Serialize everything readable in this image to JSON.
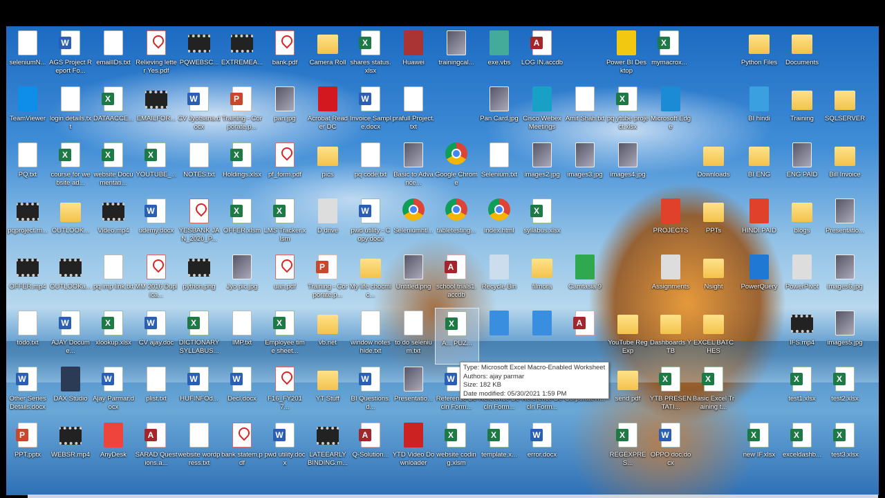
{
  "desktop": {
    "icons": [
      {
        "label": "seleniumN...",
        "type": "doc"
      },
      {
        "label": "AGS Project Report Fo...",
        "type": "word"
      },
      {
        "label": "emailIDs.txt",
        "type": "doc"
      },
      {
        "label": "Relieving letter Yes.pdf",
        "type": "pdf"
      },
      {
        "label": "PQWEBSC...",
        "type": "video"
      },
      {
        "label": "EXTREMEA...",
        "type": "video"
      },
      {
        "label": "bank.pdf",
        "type": "pdf"
      },
      {
        "label": "Camera Roll",
        "type": "folder"
      },
      {
        "label": "shares status.xlsx",
        "type": "excel"
      },
      {
        "label": "Huawei",
        "type": "app",
        "color": "#a33"
      },
      {
        "label": "trainingcal...",
        "type": "image"
      },
      {
        "label": "exe.vbs",
        "type": "app",
        "color": "#4a9"
      },
      {
        "label": "LOG IN.accdb",
        "type": "access"
      },
      {
        "label": "Power BI Desktop",
        "type": "app",
        "color": "#f2c811"
      },
      {
        "label": "mymacrox...",
        "type": "excel"
      },
      {
        "label": "Python Files",
        "type": "folder"
      },
      {
        "label": "Documents",
        "type": "folder"
      },
      {
        "label": "TeamViewer",
        "type": "app",
        "color": "#0e8ee9"
      },
      {
        "label": "login details.txt",
        "type": "doc"
      },
      {
        "label": "DATAACCE...",
        "type": "excel"
      },
      {
        "label": "EMAILFOR...",
        "type": "video"
      },
      {
        "label": "CV Jyotsana.docx",
        "type": "word"
      },
      {
        "label": "Training - Corporate.p...",
        "type": "ppt"
      },
      {
        "label": "pan.jpg",
        "type": "image"
      },
      {
        "label": "Acrobat Reader DC",
        "type": "app",
        "color": "#d4181f"
      },
      {
        "label": "Invoice Sample.docx",
        "type": "word"
      },
      {
        "label": "prafull Project.txt",
        "type": "doc"
      },
      {
        "label": "Pan Card.jpg",
        "type": "image"
      },
      {
        "label": "Cisco Webex Meetings",
        "type": "app",
        "color": "#19a0c7"
      },
      {
        "label": "Amit Shah.txt",
        "type": "doc"
      },
      {
        "label": "pq ytube project.xlsx",
        "type": "excel"
      },
      {
        "label": "Microsoft Edge",
        "type": "app",
        "color": "#1a8bd4"
      },
      {
        "label": "BI hindi",
        "type": "app",
        "color": "#3aa0e0"
      },
      {
        "label": "Training",
        "type": "folder"
      },
      {
        "label": "SQLSERVER",
        "type": "folder"
      },
      {
        "label": "PQ.txt",
        "type": "doc"
      },
      {
        "label": "course for website ad...",
        "type": "excel"
      },
      {
        "label": "website Documentati...",
        "type": "excel"
      },
      {
        "label": "YOUTUBE_...",
        "type": "excel"
      },
      {
        "label": "NOTES.txt",
        "type": "doc"
      },
      {
        "label": "Holdings.xlsx",
        "type": "excel"
      },
      {
        "label": "pf_form.pdf",
        "type": "pdf"
      },
      {
        "label": "pics",
        "type": "folder"
      },
      {
        "label": "pq code.txt",
        "type": "doc"
      },
      {
        "label": "Basic to Advance...",
        "type": "image"
      },
      {
        "label": "Google Chrome",
        "type": "chrome"
      },
      {
        "label": "Selenium.txt",
        "type": "doc"
      },
      {
        "label": "images2.jpg",
        "type": "image"
      },
      {
        "label": "images3.jpg",
        "type": "image"
      },
      {
        "label": "images4.jpg",
        "type": "image"
      },
      {
        "label": "Downloads",
        "type": "folder"
      },
      {
        "label": "BI ENG",
        "type": "folder"
      },
      {
        "label": "ENG PAID",
        "type": "image"
      },
      {
        "label": "Bill Invoice",
        "type": "folder"
      },
      {
        "label": "pqproject.m...",
        "type": "video"
      },
      {
        "label": "OUTLOOK...",
        "type": "folder"
      },
      {
        "label": "Video.mp4",
        "type": "video"
      },
      {
        "label": "udemy.docx",
        "type": "word"
      },
      {
        "label": "YESBANK JAN_2020_P...",
        "type": "pdf"
      },
      {
        "label": "OFFER.xlsm",
        "type": "excel"
      },
      {
        "label": "LMS Tracker.xlsm",
        "type": "excel"
      },
      {
        "label": "D drive",
        "type": "app",
        "color": "#ddd"
      },
      {
        "label": "pwd utility - Copy.docx",
        "type": "word"
      },
      {
        "label": "Seleniumhtl...",
        "type": "chrome"
      },
      {
        "label": "tabletesting...",
        "type": "chrome"
      },
      {
        "label": "index.html",
        "type": "chrome"
      },
      {
        "label": "syllabus.xlsx",
        "type": "excel"
      },
      {
        "label": "PROJECTS",
        "type": "app",
        "color": "#e0412a"
      },
      {
        "label": "PPTs",
        "type": "folder"
      },
      {
        "label": "HINDI PAID",
        "type": "app",
        "color": "#e0412a"
      },
      {
        "label": "blogs",
        "type": "folder"
      },
      {
        "label": "Presentatio...",
        "type": "image"
      },
      {
        "label": "OFFER.mp4",
        "type": "video"
      },
      {
        "label": "OUTLOOKa...",
        "type": "video"
      },
      {
        "label": "pq imp link.txt",
        "type": "doc"
      },
      {
        "label": "MM 2016 Duplica...",
        "type": "pdf"
      },
      {
        "label": "python.png",
        "type": "video"
      },
      {
        "label": "Jyo pic.jpg",
        "type": "image"
      },
      {
        "label": "uan.pdf",
        "type": "pdf"
      },
      {
        "label": "Training - Corporate.p...",
        "type": "ppt"
      },
      {
        "label": "My life chocmic...",
        "type": "folder"
      },
      {
        "label": "Untitled.png",
        "type": "image"
      },
      {
        "label": "school trials1.accdb",
        "type": "access"
      },
      {
        "label": "Recycle Bin",
        "type": "app",
        "color": "#cde"
      },
      {
        "label": "filmora",
        "type": "folder"
      },
      {
        "label": "Camtasia 9",
        "type": "app",
        "color": "#2fa84f"
      },
      {
        "label": "Assignments",
        "type": "app",
        "color": "#ddd"
      },
      {
        "label": "Nsight",
        "type": "folder"
      },
      {
        "label": "PowerQuery",
        "type": "app",
        "color": "#1e78d4"
      },
      {
        "label": "PowerPivot",
        "type": "app",
        "color": "#ddd"
      },
      {
        "label": "images6.jpg",
        "type": "image"
      },
      {
        "label": "todo.txt",
        "type": "doc"
      },
      {
        "label": "AJAY Docume...",
        "type": "word"
      },
      {
        "label": "xlookup.xlsx",
        "type": "excel"
      },
      {
        "label": "CV ajay.doc",
        "type": "word"
      },
      {
        "label": "DICTIONARY SYLLABUS...",
        "type": "excel"
      },
      {
        "label": "IMP.txt",
        "type": "doc"
      },
      {
        "label": "Employee time sheet...",
        "type": "excel"
      },
      {
        "label": "vb.net",
        "type": "folder"
      },
      {
        "label": "window notes hide.txt",
        "type": "doc"
      },
      {
        "label": "to do selenium.txt",
        "type": "doc"
      },
      {
        "label": "A... PUZ...",
        "type": "excel",
        "selected": true
      },
      {
        "label": "",
        "type": "app",
        "color": "#3a8ee0"
      },
      {
        "label": "",
        "type": "app",
        "color": "#3a8ee0"
      },
      {
        "label": "",
        "type": "access"
      },
      {
        "label": "YouTube RegExp",
        "type": "folder"
      },
      {
        "label": "Dashboards YTB",
        "type": "folder"
      },
      {
        "label": "EXCEL BATCHES",
        "type": "folder"
      },
      {
        "label": "IFS.mp4",
        "type": "video"
      },
      {
        "label": "images5.jpg",
        "type": "image"
      },
      {
        "label": "Other Series Details.docx",
        "type": "word"
      },
      {
        "label": "DAX Studio",
        "type": "app",
        "color": "#2b3a55"
      },
      {
        "label": "Ajay Parmar.docx",
        "type": "word"
      },
      {
        "label": "plist.txt",
        "type": "doc"
      },
      {
        "label": "HUFINFOd...",
        "type": "word"
      },
      {
        "label": "Decl.docx",
        "type": "word"
      },
      {
        "label": "F16_FY2017...",
        "type": "pdf"
      },
      {
        "label": "YT Stuff",
        "type": "folder"
      },
      {
        "label": "BI Questions.d...",
        "type": "word"
      },
      {
        "label": "Presentatio...",
        "type": "image"
      },
      {
        "label": "Reference Decln Form...",
        "type": "word"
      },
      {
        "label": "Reference Decln Form...",
        "type": "word"
      },
      {
        "label": "Reference Decln Form...",
        "type": "word"
      },
      {
        "label": "CorporateTr...",
        "type": "excel"
      },
      {
        "label": "send pdf",
        "type": "folder"
      },
      {
        "label": "YTB PRESENTATI...",
        "type": "excel"
      },
      {
        "label": "Basic Excel Training t...",
        "type": "excel"
      },
      {
        "label": "test1.xlsx",
        "type": "excel"
      },
      {
        "label": "test2.xlsx",
        "type": "excel"
      },
      {
        "label": "PPT.pptx",
        "type": "ppt"
      },
      {
        "label": "WEBSR.mp4",
        "type": "video"
      },
      {
        "label": "AnyDesk",
        "type": "app",
        "color": "#ef443b"
      },
      {
        "label": "SARAD Questions.a...",
        "type": "access"
      },
      {
        "label": "website wordpress.txt",
        "type": "doc"
      },
      {
        "label": "bank statem.pdf",
        "type": "pdf"
      },
      {
        "label": "pwd utility.docx",
        "type": "word"
      },
      {
        "label": "LATEEARLY BINDING.m...",
        "type": "video"
      },
      {
        "label": "Q-Solution...",
        "type": "access"
      },
      {
        "label": "YTD Video Downloader",
        "type": "app",
        "color": "#c22"
      },
      {
        "label": "website coding.xlsm",
        "type": "excel"
      },
      {
        "label": "template.x...",
        "type": "excel"
      },
      {
        "label": "error.docx",
        "type": "word"
      },
      {
        "label": "REGEXPRES...",
        "type": "excel"
      },
      {
        "label": "OPPO doc.docx",
        "type": "word"
      },
      {
        "label": "new IF.xlsx",
        "type": "excel"
      },
      {
        "label": "exceldashb...",
        "type": "excel"
      },
      {
        "label": "test3.xlsx",
        "type": "excel"
      }
    ]
  },
  "tooltip": {
    "type": "Type: Microsoft Excel Macro-Enabled Worksheet",
    "authors": "Authors: ajay parmar",
    "size": "Size: 182 KB",
    "modified": "Date modified: 05/30/2021 1:59 PM"
  }
}
